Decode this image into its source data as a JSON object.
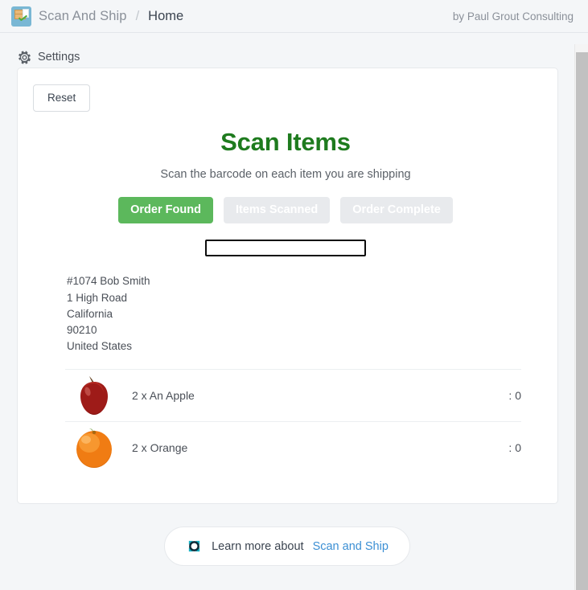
{
  "topbar": {
    "app_icon": "scan-and-ship-logo-icon",
    "brand_name": "Scan And Ship",
    "separator": "/",
    "page_name": "Home",
    "byline": "by Paul Grout Consulting"
  },
  "settings": {
    "icon": "gear-icon",
    "label": "Settings"
  },
  "card": {
    "reset_label": "Reset",
    "title": "Scan Items",
    "subtitle": "Scan the barcode on each item you are shipping",
    "steps": [
      {
        "label": "Order Found",
        "state": "active"
      },
      {
        "label": "Items Scanned",
        "state": "inactive"
      },
      {
        "label": "Order Complete",
        "state": "inactive"
      }
    ],
    "scan_input": {
      "value": "",
      "placeholder": ""
    },
    "address": [
      "#1074 Bob Smith",
      "1 High Road",
      "California",
      "90210",
      "United States"
    ],
    "items": [
      {
        "thumb": "apple-image",
        "label": "2 x An Apple",
        "count": ": 0"
      },
      {
        "thumb": "orange-image",
        "label": "2 x Orange",
        "count": ": 0"
      }
    ]
  },
  "footer": {
    "icon": "scan-and-ship-badge-icon",
    "text": "Learn more about",
    "link_label": "Scan and Ship"
  },
  "colors": {
    "accent_green": "#5cb85c",
    "title_green": "#1e7b1e",
    "link_blue": "#3b8fd4",
    "page_bg": "#f4f6f8",
    "inactive_step": "#e8eaed"
  }
}
